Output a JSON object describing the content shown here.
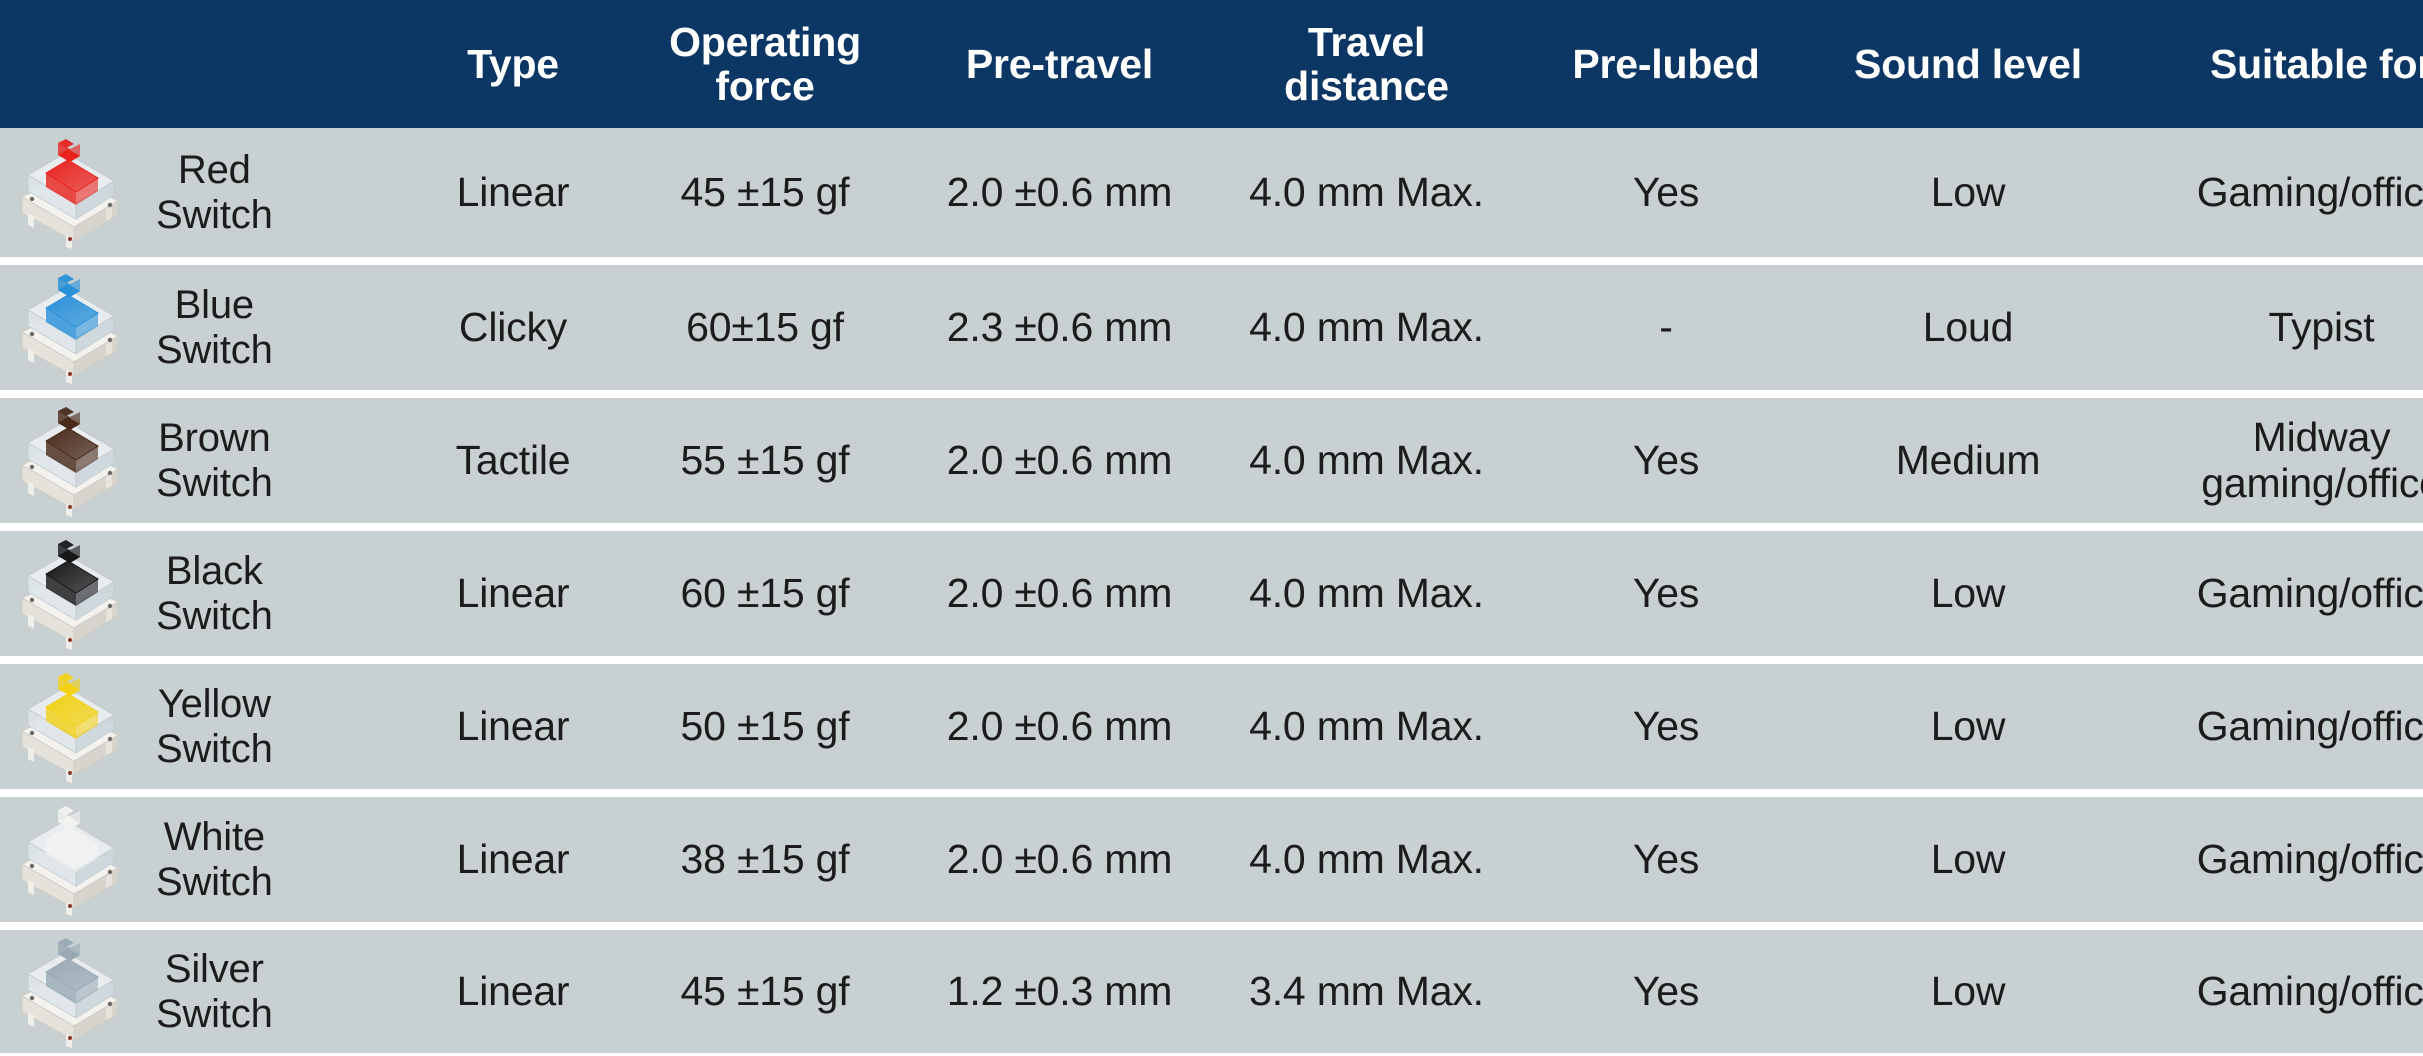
{
  "table": {
    "columns": [
      {
        "key": "switch",
        "label": ""
      },
      {
        "key": "type",
        "label": "Type"
      },
      {
        "key": "operating",
        "label": "Operating\nforce"
      },
      {
        "key": "pretravel",
        "label": "Pre-travel"
      },
      {
        "key": "travel",
        "label": "Travel\ndistance"
      },
      {
        "key": "prelubed",
        "label": "Pre-lubed"
      },
      {
        "key": "sound",
        "label": "Sound level"
      },
      {
        "key": "suitable",
        "label": "Suitable for"
      }
    ],
    "rows": [
      {
        "name": "Red\nSwitch",
        "icon": "red-switch-image",
        "stem_color": "#e8241f",
        "type": "Linear",
        "operating_force": "45 ±15 gf",
        "pre_travel": "2.0 ±0.6 mm",
        "travel_distance": "4.0 mm Max.",
        "pre_lubed": "Yes",
        "sound_level": "Low",
        "suitable_for": "Gaming/office"
      },
      {
        "name": "Blue\nSwitch",
        "icon": "blue-switch-image",
        "stem_color": "#2a90d8",
        "type": "Clicky",
        "operating_force": "60±15 gf",
        "pre_travel": "2.3 ±0.6 mm",
        "travel_distance": "4.0 mm Max.",
        "pre_lubed": "-",
        "sound_level": "Loud",
        "suitable_for": "Typist"
      },
      {
        "name": "Brown\nSwitch",
        "icon": "brown-switch-image",
        "stem_color": "#4a2b1c",
        "type": "Tactile",
        "operating_force": "55 ±15 gf",
        "pre_travel": "2.0 ±0.6 mm",
        "travel_distance": "4.0 mm Max.",
        "pre_lubed": "Yes",
        "sound_level": "Medium",
        "suitable_for": "Midway\ngaming/office"
      },
      {
        "name": "Black\nSwitch",
        "icon": "black-switch-image",
        "stem_color": "#18181a",
        "type": "Linear",
        "operating_force": "60 ±15 gf",
        "pre_travel": "2.0 ±0.6 mm",
        "travel_distance": "4.0 mm Max.",
        "pre_lubed": "Yes",
        "sound_level": "Low",
        "suitable_for": "Gaming/office"
      },
      {
        "name": "Yellow\nSwitch",
        "icon": "yellow-switch-image",
        "stem_color": "#f2d117",
        "type": "Linear",
        "operating_force": "50 ±15 gf",
        "pre_travel": "2.0 ±0.6 mm",
        "travel_distance": "4.0 mm Max.",
        "pre_lubed": "Yes",
        "sound_level": "Low",
        "suitable_for": "Gaming/office"
      },
      {
        "name": "White\nSwitch",
        "icon": "white-switch-image",
        "stem_color": "#f2f2f0",
        "type": "Linear",
        "operating_force": "38 ±15 gf",
        "pre_travel": "2.0 ±0.6 mm",
        "travel_distance": "4.0 mm Max.",
        "pre_lubed": "Yes",
        "sound_level": "Low",
        "suitable_for": "Gaming/office"
      },
      {
        "name": "Silver\nSwitch",
        "icon": "silver-switch-image",
        "stem_color": "#9aa9b4",
        "type": "Linear",
        "operating_force": "45 ±15 gf",
        "pre_travel": "1.2 ±0.3 mm",
        "travel_distance": "3.4 mm Max.",
        "pre_lubed": "Yes",
        "sound_level": "Low",
        "suitable_for": "Gaming/office"
      }
    ]
  },
  "colors": {
    "header_background": "#0c3764",
    "header_text": "#ffffff",
    "row_background": "#c8d0d2",
    "row_text": "#1c1c1c",
    "row_separator": "#ffffff"
  }
}
